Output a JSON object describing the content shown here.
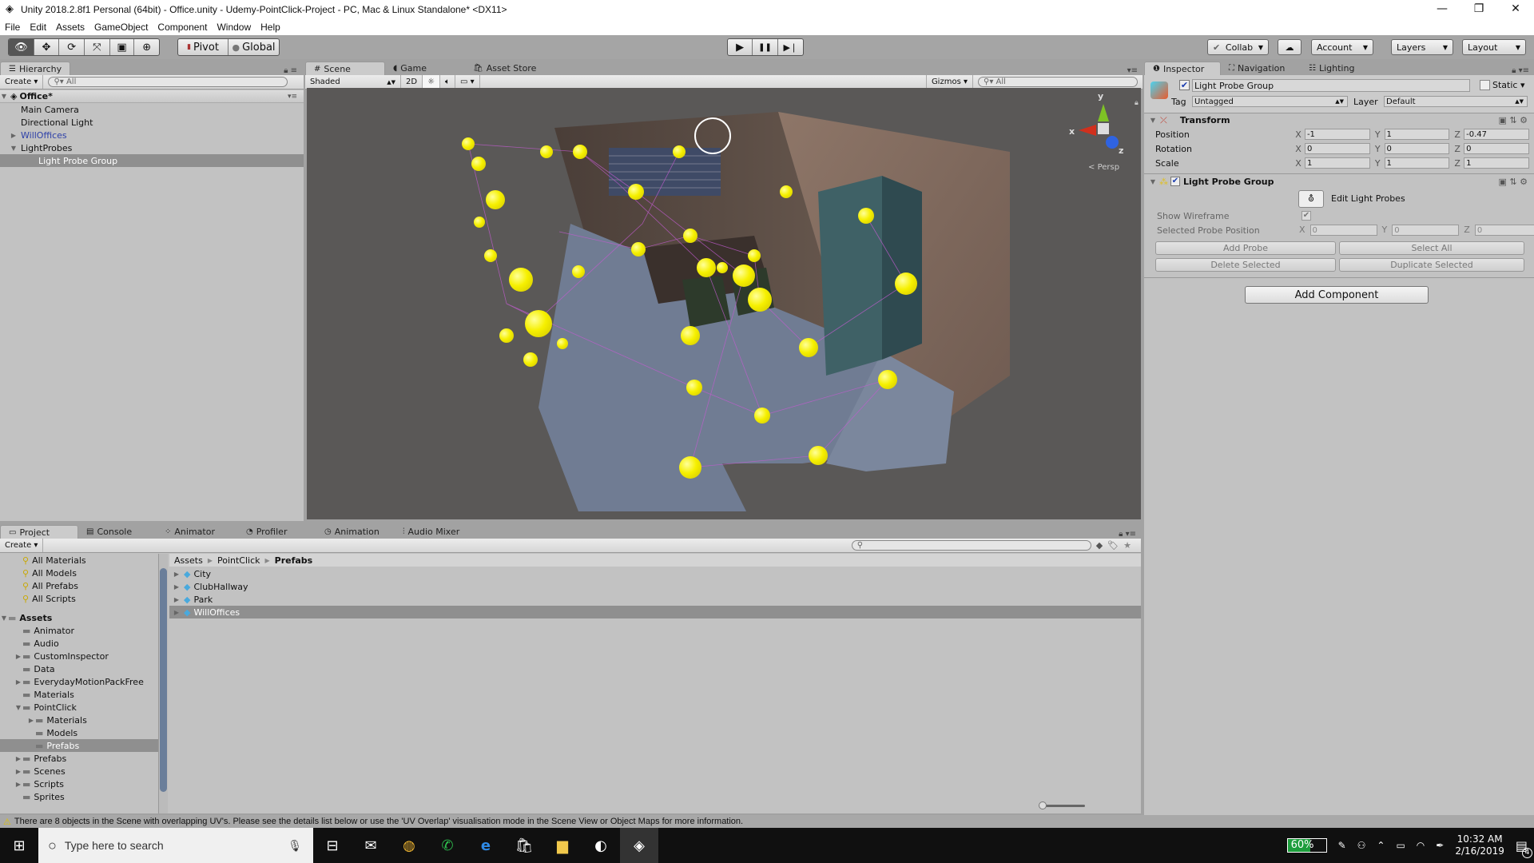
{
  "window": {
    "title": "Unity 2018.2.8f1 Personal (64bit) - Office.unity - Udemy-PointClick-Project - PC, Mac & Linux Standalone* <DX11>",
    "controls": {
      "minimize": "—",
      "restore": "❐",
      "close": "✕"
    }
  },
  "menu": [
    "File",
    "Edit",
    "Assets",
    "GameObject",
    "Component",
    "Window",
    "Help"
  ],
  "toolbar": {
    "tools": [
      {
        "name": "view-tool",
        "glyph": "👁"
      },
      {
        "name": "move-tool",
        "glyph": "✥"
      },
      {
        "name": "rotate-tool",
        "glyph": "⟳"
      },
      {
        "name": "scale-tool",
        "glyph": "⤧"
      },
      {
        "name": "rect-tool",
        "glyph": "▣"
      },
      {
        "name": "transform-tool",
        "glyph": "⊕"
      }
    ],
    "pivot": "Pivot",
    "global": "Global",
    "play": "▶",
    "pause": "❚❚",
    "step": "▶❘",
    "collab": "Collab",
    "account": "Account",
    "layers": "Layers",
    "layout": "Layout"
  },
  "hierarchy": {
    "tab": "Hierarchy",
    "create": "Create",
    "search_placeholder": "All",
    "scene": "Office*",
    "items": [
      {
        "label": "Main Camera",
        "indent": 1,
        "expander": "",
        "selected": false,
        "prefab": false
      },
      {
        "label": "Directional Light",
        "indent": 1,
        "expander": "",
        "selected": false,
        "prefab": false
      },
      {
        "label": "WillOffices",
        "indent": 1,
        "expander": "▶",
        "selected": false,
        "prefab": true
      },
      {
        "label": "LightProbes",
        "indent": 1,
        "expander": "▼",
        "selected": false,
        "prefab": false
      },
      {
        "label": "Light Probe Group",
        "indent": 2,
        "expander": "",
        "selected": true,
        "prefab": false
      }
    ]
  },
  "scene_view": {
    "tabs": [
      "Scene",
      "Game",
      "Asset Store"
    ],
    "shading": "Shaded",
    "mode_2d": "2D",
    "gizmos": "Gizmos",
    "search_placeholder": "All",
    "gizmo_axes": {
      "x": "x",
      "y": "y",
      "z": "z"
    },
    "projection": "Persp"
  },
  "inspector": {
    "tabs": [
      "Inspector",
      "Navigation",
      "Lighting"
    ],
    "object_name": "Light Probe Group",
    "static_label": "Static",
    "tag_label": "Tag",
    "tag_value": "Untagged",
    "layer_label": "Layer",
    "layer_value": "Default",
    "transform": {
      "title": "Transform",
      "rows": [
        {
          "label": "Position",
          "x": "-1",
          "y": "1",
          "z": "-0.47"
        },
        {
          "label": "Rotation",
          "x": "0",
          "y": "0",
          "z": "0"
        },
        {
          "label": "Scale",
          "x": "1",
          "y": "1",
          "z": "1"
        }
      ]
    },
    "light_probe_group": {
      "title": "Light Probe Group",
      "edit_label": "Edit Light Probes",
      "show_wireframe_label": "Show Wireframe",
      "show_wireframe": true,
      "selected_position_label": "Selected Probe Position",
      "selected_position": {
        "x": "0",
        "y": "0",
        "z": "0"
      },
      "buttons": [
        "Add Probe",
        "Select All",
        "Delete Selected",
        "Duplicate Selected"
      ]
    },
    "add_component": "Add Component"
  },
  "bottom_panel": {
    "tabs": [
      "Project",
      "Console",
      "Animator",
      "Profiler",
      "Animation",
      "Audio Mixer"
    ],
    "create": "Create",
    "favorites": [
      "All Materials",
      "All Models",
      "All Prefabs",
      "All Scripts"
    ],
    "assets_root": "Assets",
    "folders": [
      {
        "label": "Animator",
        "indent": 1,
        "expander": ""
      },
      {
        "label": "Audio",
        "indent": 1,
        "expander": ""
      },
      {
        "label": "CustomInspector",
        "indent": 1,
        "expander": "▶"
      },
      {
        "label": "Data",
        "indent": 1,
        "expander": ""
      },
      {
        "label": "EverydayMotionPackFree",
        "indent": 1,
        "expander": "▶"
      },
      {
        "label": "Materials",
        "indent": 1,
        "expander": ""
      },
      {
        "label": "PointClick",
        "indent": 1,
        "expander": "▼"
      },
      {
        "label": "Materials",
        "indent": 2,
        "expander": "▶"
      },
      {
        "label": "Models",
        "indent": 2,
        "expander": ""
      },
      {
        "label": "Prefabs",
        "indent": 2,
        "expander": "",
        "selected": true
      },
      {
        "label": "Prefabs",
        "indent": 1,
        "expander": "▶"
      },
      {
        "label": "Scenes",
        "indent": 1,
        "expander": "▶"
      },
      {
        "label": "Scripts",
        "indent": 1,
        "expander": "▶"
      },
      {
        "label": "Sprites",
        "indent": 1,
        "expander": ""
      }
    ],
    "breadcrumb": [
      "Assets",
      "PointClick",
      "Prefabs"
    ],
    "files": [
      {
        "label": "City",
        "selected": false
      },
      {
        "label": "ClubHallway",
        "selected": false
      },
      {
        "label": "Park",
        "selected": false
      },
      {
        "label": "WillOffices",
        "selected": true
      }
    ]
  },
  "status": {
    "message": "There are 8 objects in the Scene with overlapping UV's. Please see the details list below or use the 'UV Overlap' visualisation mode in the Scene View or Object Maps for more information."
  },
  "taskbar": {
    "search_placeholder": "Type here to search",
    "battery": "60%",
    "battery_level": 0.6,
    "time": "10:32 AM",
    "date": "2/16/2019",
    "notifications": "4"
  },
  "colors": {
    "probe_yellow": "#f6f000",
    "selection_gray": "#8f8f8f",
    "prefab_blue": "#2c3fa8"
  }
}
